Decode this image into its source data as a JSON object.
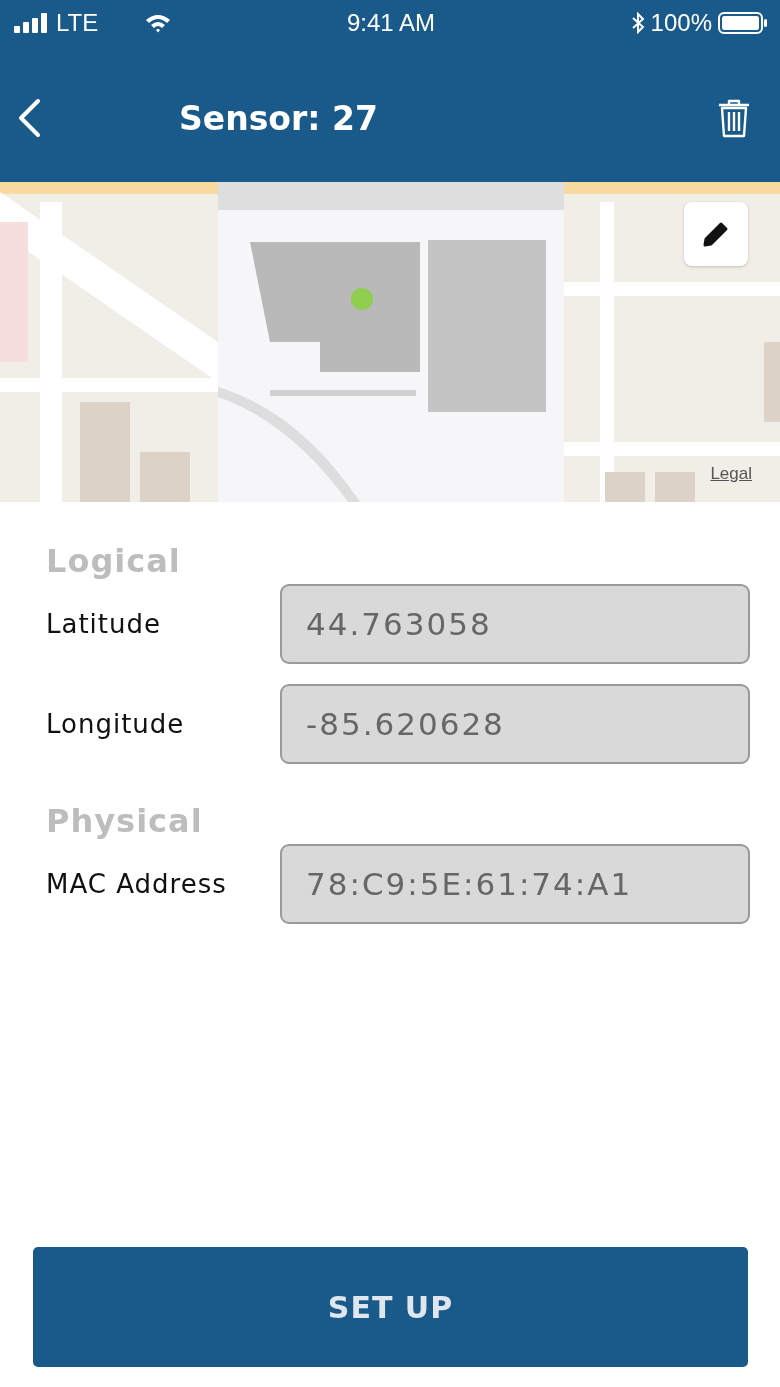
{
  "status_bar": {
    "carrier": "LTE",
    "time": "9:41 AM",
    "battery": "100%"
  },
  "nav": {
    "title": "Sensor: 27"
  },
  "map": {
    "legal_link": "Legal"
  },
  "sections": [
    {
      "heading": "Logical",
      "fields": [
        {
          "label": "Latitude",
          "value": "44.763058"
        },
        {
          "label": "Longitude",
          "value": "-85.620628"
        }
      ]
    },
    {
      "heading": "Physical",
      "fields": [
        {
          "label": "MAC Address",
          "value": "78:C9:5E:61:74:A1"
        }
      ]
    }
  ],
  "primary_button": "SET UP"
}
